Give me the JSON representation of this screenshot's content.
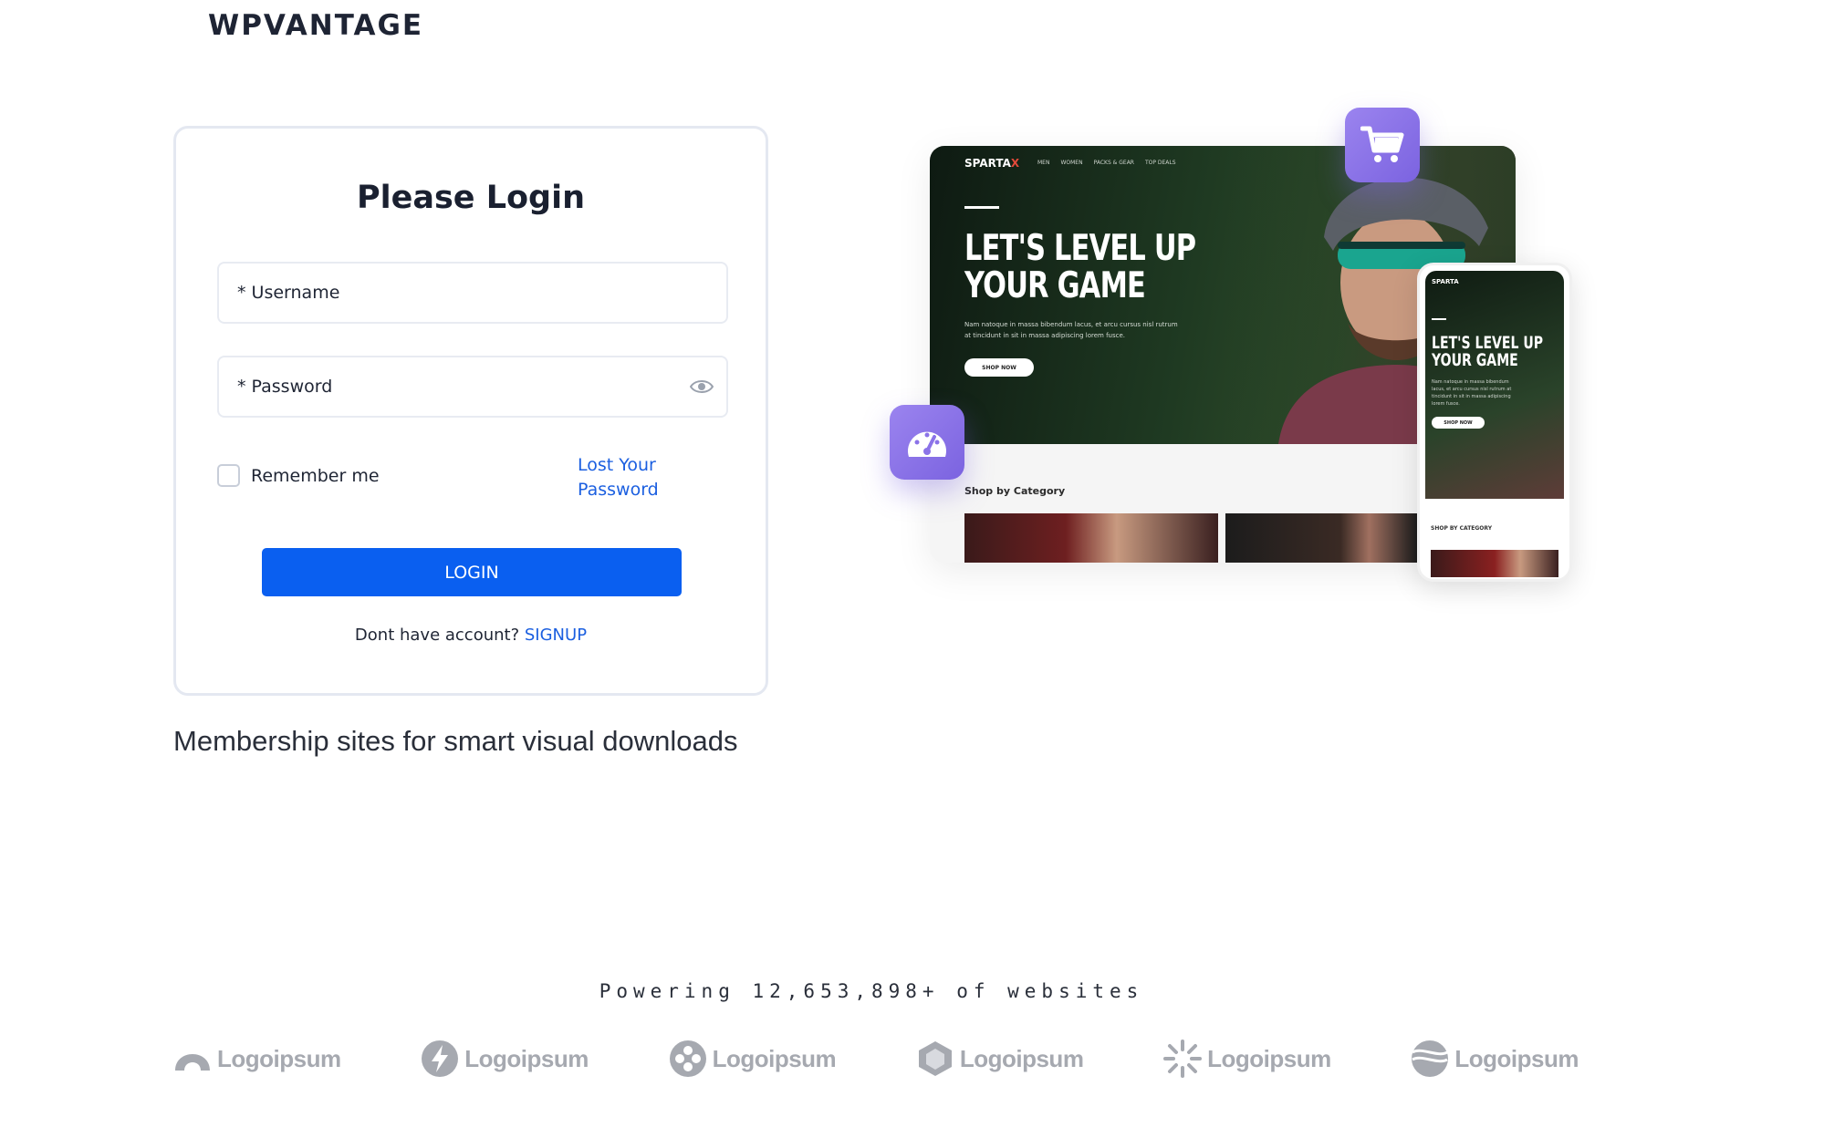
{
  "brand": {
    "logo_text": "WPVANTAGE"
  },
  "login": {
    "title": "Please Login",
    "username_placeholder": "* Username",
    "password_placeholder": "* Password",
    "remember_label": "Remember me",
    "lost_password_label": "Lost Your Password",
    "login_button": "LOGIN",
    "signup_prompt": "Dont have account?",
    "signup_link": "SIGNUP"
  },
  "tagline": "Membership sites for smart visual downloads",
  "showcase": {
    "desktop": {
      "brand": "SPARTA",
      "brand_accent": "X",
      "nav": [
        "MEN",
        "WOMEN",
        "PACKS & GEAR",
        "TOP DEALS"
      ],
      "headline_line1": "LET'S LEVEL UP",
      "headline_line2": "YOUR GAME",
      "subtext": "Nam natoque in massa bibendum lacus, et arcu cursus nisl rutrum at tincidunt in sit in massa adipiscing lorem fusce.",
      "cta": "SHOP NOW",
      "category_heading": "Shop by Category"
    },
    "phone": {
      "brand": "SPARTA",
      "headline_line1": "LET'S LEVEL UP",
      "headline_line2": "YOUR GAME",
      "subtext": "Nam natoque in massa bibendum lacus, et arcu cursus nisl rutrum at tincidunt in sit in massa adipiscing lorem fusce.",
      "cta": "SHOP NOW",
      "category_heading": "SHOP BY CATEGORY"
    },
    "badges": [
      "shopping-cart-icon",
      "speedometer-icon"
    ]
  },
  "powering_text": "Powering 12,653,898+ of websites",
  "partner_logos": [
    "Logoipsum",
    "Logoipsum",
    "Logoipsum",
    "Logoipsum",
    "Logoipsum",
    "Logoipsum"
  ],
  "colors": {
    "primary": "#0a5ff0",
    "link": "#1b5fe0",
    "badge": "#8b73e8",
    "logo_gray": "#a6a9b0"
  }
}
